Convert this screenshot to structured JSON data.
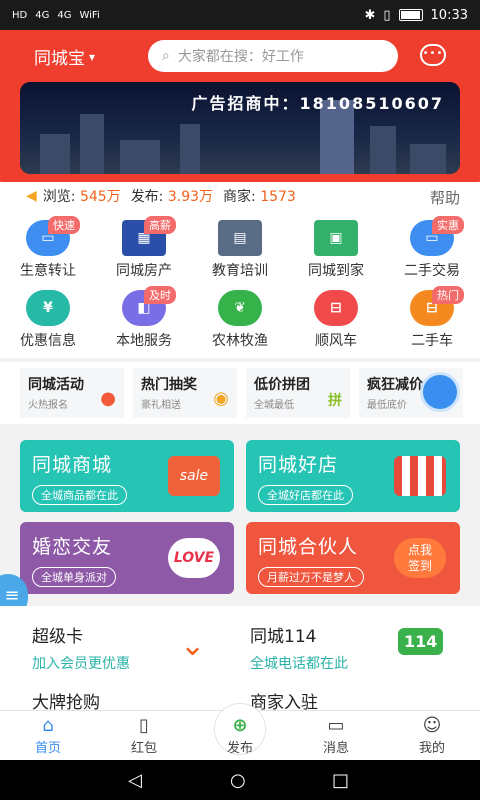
{
  "status": {
    "left": [
      "HD",
      "4G",
      "4G",
      "WiFi"
    ],
    "time": "10:33"
  },
  "header": {
    "city": "同城宝",
    "search_placeholder": "大家都在搜：好工作",
    "chat_icon": "chat-bubble-icon"
  },
  "banner": {
    "text": "广告招商中：18108510607"
  },
  "stats": {
    "views_label": "浏览:",
    "views_value": "545万",
    "posts_label": "发布:",
    "posts_value": "3.93万",
    "merchants_label": "商家:",
    "merchants_value": "1573",
    "help": "帮助"
  },
  "grid": [
    {
      "label": "生意转让",
      "badge": "快速",
      "color": "#3d8ef0"
    },
    {
      "label": "同城房产",
      "badge": "高薪",
      "color": "#2b4fa8"
    },
    {
      "label": "教育培训",
      "badge": "",
      "color": "#5a6b86"
    },
    {
      "label": "同城到家",
      "badge": "",
      "color": "#33b06b"
    },
    {
      "label": "二手交易",
      "badge": "实惠",
      "color": "#3d8ef0"
    },
    {
      "label": "优惠信息",
      "badge": "",
      "color": "#26b9a6"
    },
    {
      "label": "本地服务",
      "badge": "及时",
      "color": "#7a6ee6"
    },
    {
      "label": "农林牧渔",
      "badge": "",
      "color": "#35b24a"
    },
    {
      "label": "顺风车",
      "badge": "",
      "color": "#f04a4a"
    },
    {
      "label": "二手车",
      "badge": "热门",
      "color": "#f48a1f"
    }
  ],
  "promos": [
    {
      "title": "同城活动",
      "sub": "火热报名"
    },
    {
      "title": "热门抽奖",
      "sub": "豪礼相送"
    },
    {
      "title": "低价拼团",
      "sub": "全城最低"
    },
    {
      "title": "疯狂减价",
      "sub": "最低底价"
    }
  ],
  "cards": [
    {
      "title": "同城商城",
      "pill": "全城商品都在此",
      "color": "#25c4b4"
    },
    {
      "title": "同城好店",
      "pill": "全城好店都在此",
      "color": "#25c4b4"
    },
    {
      "title": "婚恋交友",
      "pill": "全城单身派对",
      "color": "#8e5aa8"
    },
    {
      "title": "同城合伙人",
      "pill": "月薪过万不是梦人",
      "color": "#f0563e"
    }
  ],
  "lower": [
    {
      "title": "超级卡",
      "sub": "加入会员更优惠"
    },
    {
      "title": "同城114",
      "sub": "全城电话都在此"
    },
    {
      "title": "大牌抢购",
      "sub": ""
    },
    {
      "title": "商家入驻",
      "sub": ""
    }
  ],
  "tabs": [
    {
      "label": "首页",
      "icon": "home-icon"
    },
    {
      "label": "红包",
      "icon": "red-packet-icon"
    },
    {
      "label": "发布",
      "icon": "post-icon"
    },
    {
      "label": "消息",
      "icon": "message-icon"
    },
    {
      "label": "我的",
      "icon": "profile-icon"
    }
  ],
  "colors": {
    "header_red": "#f03e2e",
    "accent_blue": "#3a8ef0",
    "accent_orange": "#f2611d",
    "teal": "#2bb3a8"
  }
}
